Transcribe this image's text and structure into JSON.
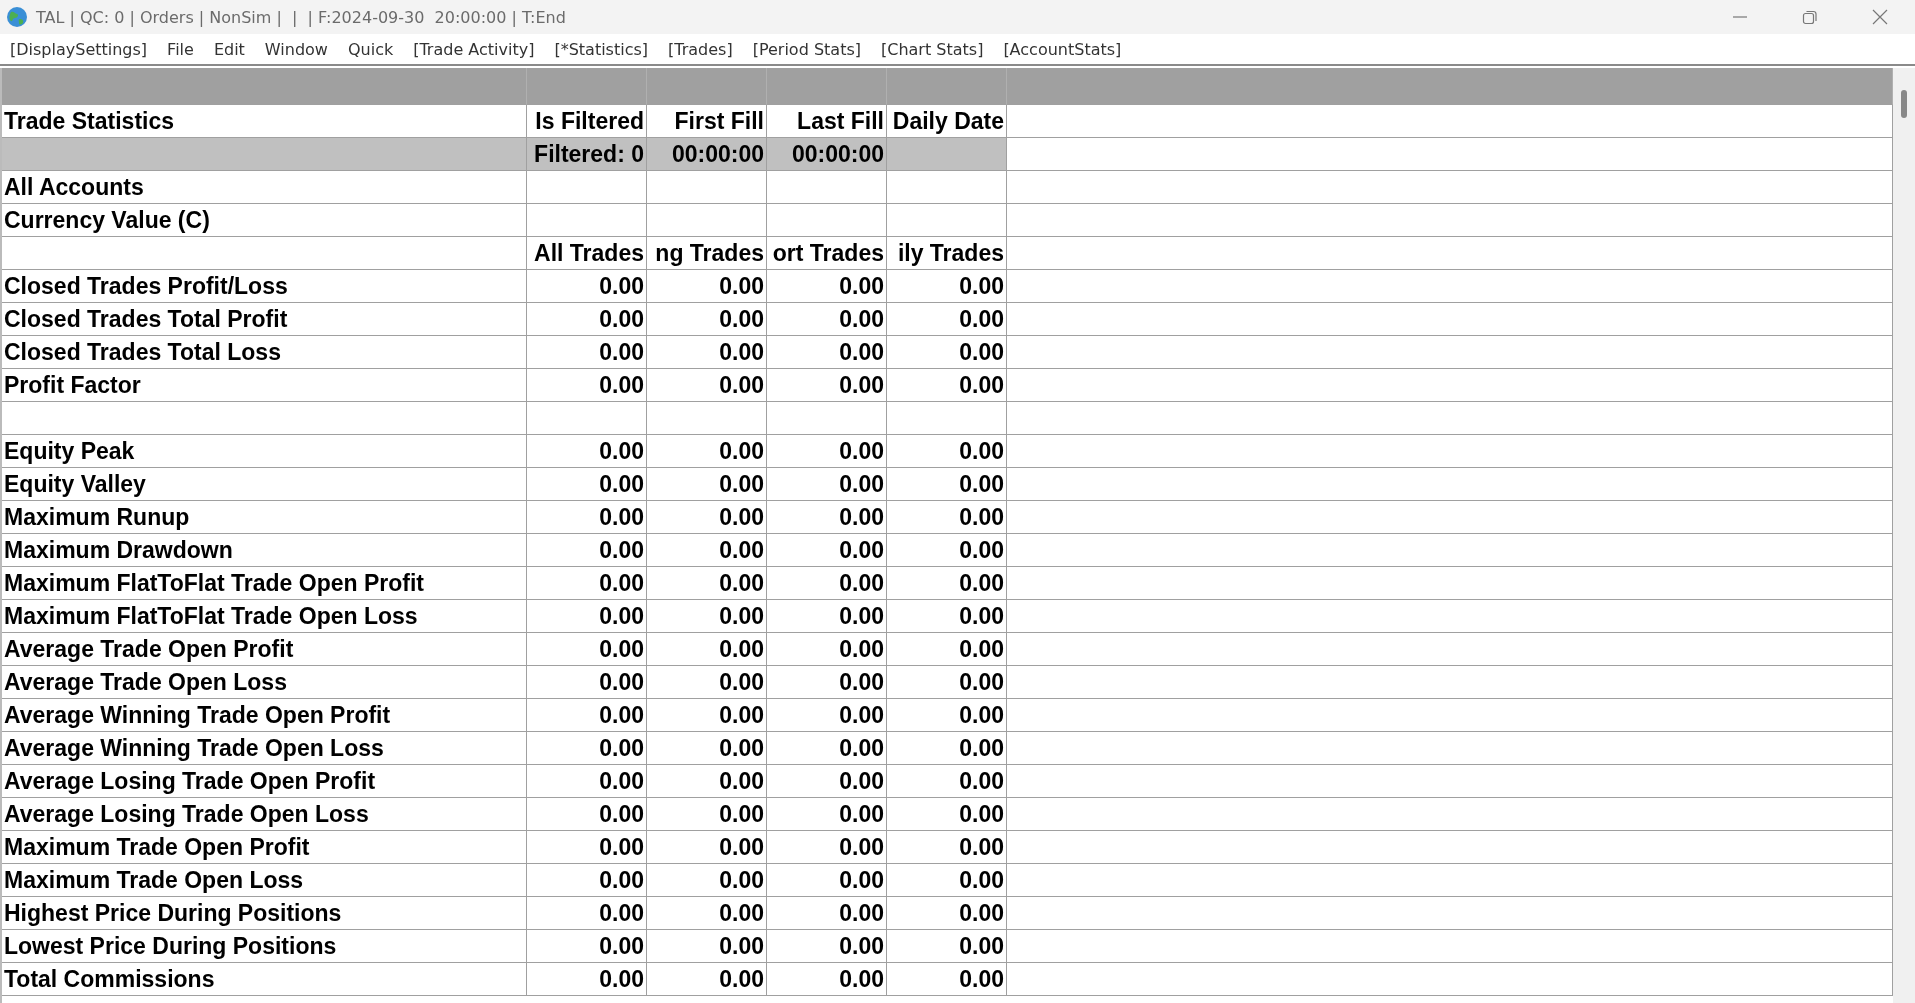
{
  "window": {
    "title": "TAL | QC: 0 | Orders | NonSim |  |  | F:2024-09-30  20:00:00 | T:End"
  },
  "menu": [
    "[DisplaySettings]",
    "File",
    "Edit",
    "Window",
    "Quick",
    "[Trade Activity]",
    "[*Statistics]",
    "[Trades]",
    "[Period Stats]",
    "[Chart Stats]",
    "[AccountStats]"
  ],
  "table": {
    "rows": [
      {
        "kind": "heading",
        "label": "Trade Statistics",
        "values": [
          "Is Filtered",
          "First Fill",
          "Last Fill",
          "Daily Date"
        ]
      },
      {
        "kind": "filter",
        "values": [
          "Filtered: 0",
          "00:00:00",
          "00:00:00"
        ]
      },
      {
        "kind": "data",
        "label": "All Accounts"
      },
      {
        "kind": "data",
        "label": "Currency Value (C)"
      },
      {
        "kind": "heading",
        "values": [
          "All Trades",
          "ng Trades",
          "ort Trades",
          "ily Trades"
        ]
      },
      {
        "kind": "data",
        "label": "Closed Trades Profit/Loss",
        "values": [
          "0.00",
          "0.00",
          "0.00",
          "0.00"
        ]
      },
      {
        "kind": "data",
        "label": "Closed Trades Total Profit",
        "values": [
          "0.00",
          "0.00",
          "0.00",
          "0.00"
        ]
      },
      {
        "kind": "data",
        "label": "Closed Trades Total Loss",
        "values": [
          "0.00",
          "0.00",
          "0.00",
          "0.00"
        ]
      },
      {
        "kind": "data",
        "label": "Profit Factor",
        "values": [
          "0.00",
          "0.00",
          "0.00",
          "0.00"
        ]
      },
      {
        "kind": "blank"
      },
      {
        "kind": "data",
        "label": "Equity Peak",
        "values": [
          "0.00",
          "0.00",
          "0.00",
          "0.00"
        ]
      },
      {
        "kind": "data",
        "label": "Equity Valley",
        "values": [
          "0.00",
          "0.00",
          "0.00",
          "0.00"
        ]
      },
      {
        "kind": "data",
        "label": "Maximum Runup",
        "values": [
          "0.00",
          "0.00",
          "0.00",
          "0.00"
        ]
      },
      {
        "kind": "data",
        "label": "Maximum Drawdown",
        "values": [
          "0.00",
          "0.00",
          "0.00",
          "0.00"
        ]
      },
      {
        "kind": "data",
        "label": "Maximum FlatToFlat Trade Open Profit",
        "values": [
          "0.00",
          "0.00",
          "0.00",
          "0.00"
        ]
      },
      {
        "kind": "data",
        "label": "Maximum FlatToFlat Trade Open Loss",
        "values": [
          "0.00",
          "0.00",
          "0.00",
          "0.00"
        ]
      },
      {
        "kind": "data",
        "label": "Average Trade Open Profit",
        "values": [
          "0.00",
          "0.00",
          "0.00",
          "0.00"
        ]
      },
      {
        "kind": "data",
        "label": "Average Trade Open Loss",
        "values": [
          "0.00",
          "0.00",
          "0.00",
          "0.00"
        ]
      },
      {
        "kind": "data",
        "label": "Average Winning Trade Open Profit",
        "values": [
          "0.00",
          "0.00",
          "0.00",
          "0.00"
        ]
      },
      {
        "kind": "data",
        "label": "Average Winning Trade Open Loss",
        "values": [
          "0.00",
          "0.00",
          "0.00",
          "0.00"
        ]
      },
      {
        "kind": "data",
        "label": "Average Losing Trade Open Profit",
        "values": [
          "0.00",
          "0.00",
          "0.00",
          "0.00"
        ]
      },
      {
        "kind": "data",
        "label": "Average Losing Trade Open Loss",
        "values": [
          "0.00",
          "0.00",
          "0.00",
          "0.00"
        ]
      },
      {
        "kind": "data",
        "label": "Maximum Trade Open Profit",
        "values": [
          "0.00",
          "0.00",
          "0.00",
          "0.00"
        ]
      },
      {
        "kind": "data",
        "label": "Maximum Trade Open Loss",
        "values": [
          "0.00",
          "0.00",
          "0.00",
          "0.00"
        ]
      },
      {
        "kind": "data",
        "label": "Highest Price During Positions",
        "values": [
          "0.00",
          "0.00",
          "0.00",
          "0.00"
        ]
      },
      {
        "kind": "data",
        "label": "Lowest Price During Positions",
        "values": [
          "0.00",
          "0.00",
          "0.00",
          "0.00"
        ]
      },
      {
        "kind": "data",
        "label": "Total Commissions",
        "values": [
          "0.00",
          "0.00",
          "0.00",
          "0.00"
        ]
      }
    ]
  }
}
